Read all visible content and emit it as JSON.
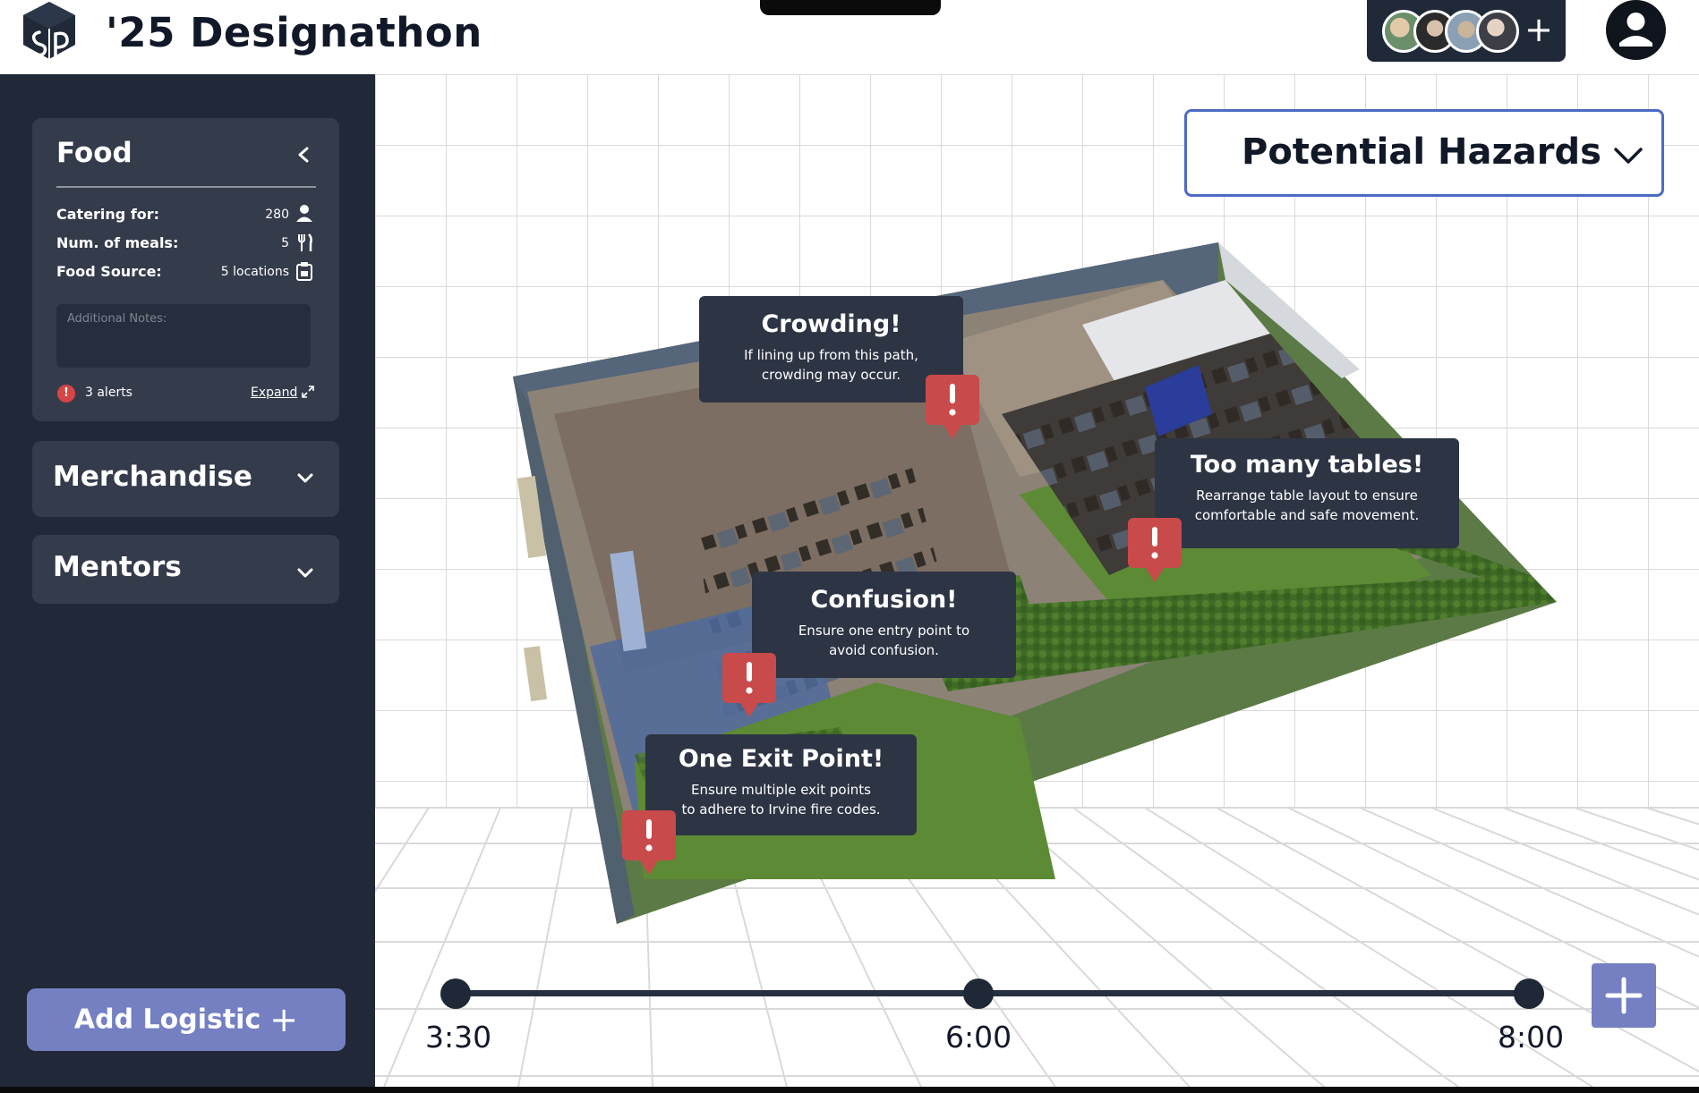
{
  "app": {
    "title": "'25 Designathon",
    "logo_icon": "sp-cube-logo-icon",
    "add_collaborator_label": "+",
    "collaborator_count": 4,
    "profile_icon": "user-icon"
  },
  "sidebar": {
    "food": {
      "title": "Food",
      "collapse_icon": "chevron-left-icon",
      "stats": [
        {
          "label": "Catering for:",
          "value": "280",
          "icon": "person-icon"
        },
        {
          "label": "Num. of meals:",
          "value": "5",
          "icon": "fork-knife-icon"
        },
        {
          "label": "Food Source:",
          "value": "5 locations",
          "icon": "clipboard-icon"
        }
      ],
      "notes_placeholder": "Additional Notes:",
      "alerts_icon": "!",
      "alerts_text": "3 alerts",
      "expand_label": "Expand"
    },
    "merchandise": {
      "title": "Merchandise",
      "icon": "chevron-down-icon"
    },
    "mentors": {
      "title": "Mentors",
      "icon": "chevron-down-icon"
    },
    "add_logistic_label": "Add Logistic",
    "add_logistic_icon": "+"
  },
  "main": {
    "hazards_dropdown": {
      "selected": "Potential Hazards",
      "icon": "chevron-down-icon"
    },
    "hazards": [
      {
        "title": "Crowding!",
        "body": "If lining up from this path,\ncrowding may occur."
      },
      {
        "title": "Too many tables!",
        "body": "Rearrange table layout to ensure\ncomfortable and safe movement."
      },
      {
        "title": "Confusion!",
        "body": "Ensure one entry point to\navoid confusion."
      },
      {
        "title": "One Exit Point!",
        "body": "Ensure multiple exit points\nto adhere to Irvine fire codes."
      }
    ],
    "pin_mark": "!",
    "timeline": {
      "labels": [
        "3:30",
        "6:00",
        "8:00"
      ],
      "add_icon": "plus-icon"
    }
  },
  "colors": {
    "sidebar_bg": "#212838",
    "card_bg": "#343b4b",
    "accent": "#7480c2",
    "alert_red": "#d64545",
    "tooltip_bg": "#2d3444",
    "dropdown_border": "#4d6ac7"
  }
}
